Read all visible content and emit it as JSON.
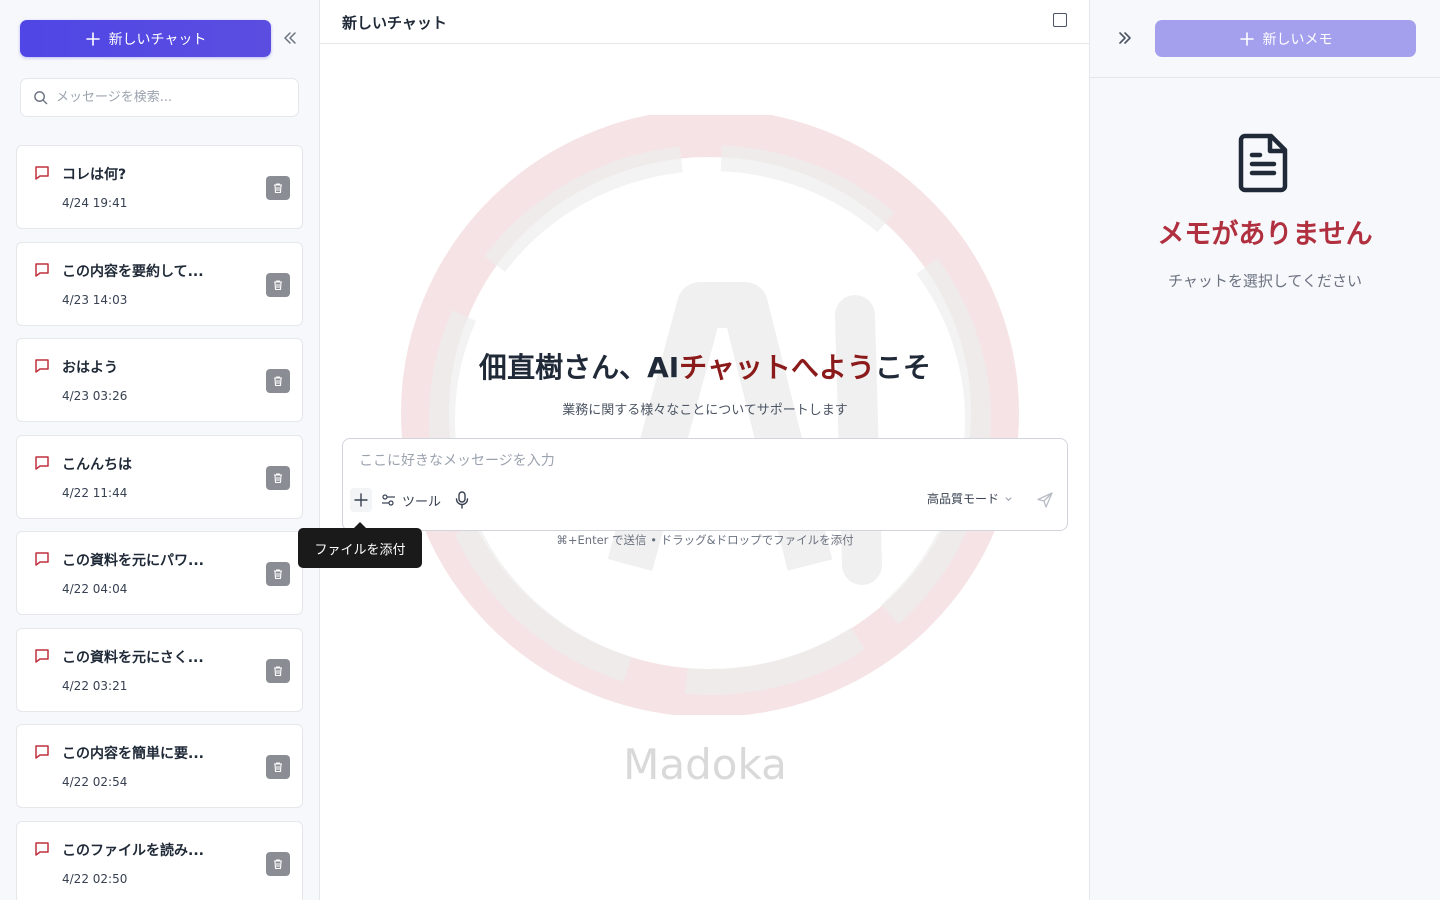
{
  "sidebar": {
    "new_chat_label": "新しいチャット",
    "search_placeholder": "メッセージを検索...",
    "chats": [
      {
        "title": "コレは何?",
        "date": "4/24 19:41"
      },
      {
        "title": "この内容を要約して...",
        "date": "4/23 14:03"
      },
      {
        "title": "おはよう",
        "date": "4/23 03:26"
      },
      {
        "title": "こんんちは",
        "date": "4/22 11:44"
      },
      {
        "title": "この資料を元にパワ...",
        "date": "4/22 04:04"
      },
      {
        "title": "この資料を元にさく...",
        "date": "4/22 03:21"
      },
      {
        "title": "この内容を簡単に要...",
        "date": "4/22 02:54"
      },
      {
        "title": "このファイルを読み...",
        "date": "4/22 02:50"
      }
    ]
  },
  "main": {
    "title": "新しいチャット",
    "welcome_prefix": "佃直樹さん、AI",
    "welcome_accent": "チャットへよう",
    "welcome_suffix": "こそ",
    "subtitle": "業務に関する様々なことについてサポートします",
    "input_placeholder": "ここに好きなメッセージを入力",
    "tools_label": "ツール",
    "mode_label": "高品質モード",
    "hint": "⌘+Enter で送信 • ドラッグ&ドロップでファイルを添付",
    "tooltip": "ファイルを添付",
    "watermark": "Madoka"
  },
  "memo": {
    "new_memo_label": "新しいメモ",
    "empty_title": "メモがありません",
    "empty_sub": "チャットを選択してください"
  },
  "colors": {
    "primary": "#4f46e5",
    "primary_light": "#a5a0ee",
    "accent_red": "#8b1a1a",
    "memo_red": "#b0303f"
  }
}
